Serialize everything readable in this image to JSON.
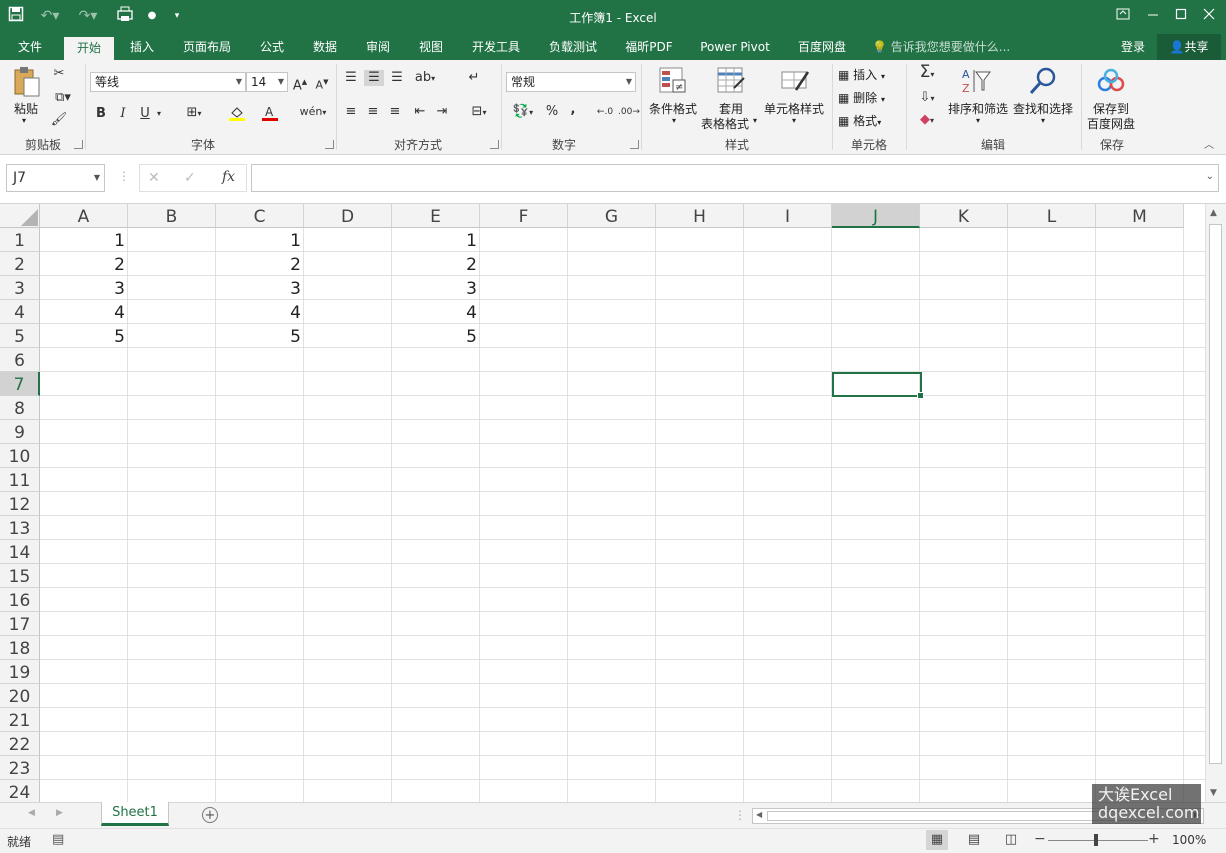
{
  "title_bar": {
    "title": "工作簿1 - Excel",
    "window_controls": [
      "ribbon-display-icon",
      "minimize-icon",
      "maximize-icon",
      "close-icon"
    ]
  },
  "tabs": [
    {
      "label": "文件"
    },
    {
      "label": "开始"
    },
    {
      "label": "插入"
    },
    {
      "label": "页面布局"
    },
    {
      "label": "公式"
    },
    {
      "label": "数据"
    },
    {
      "label": "审阅"
    },
    {
      "label": "视图"
    },
    {
      "label": "开发工具"
    },
    {
      "label": "负载测试"
    },
    {
      "label": "福昕PDF"
    },
    {
      "label": "Power Pivot"
    },
    {
      "label": "百度网盘"
    }
  ],
  "tell_me": "告诉我您想要做什么...",
  "login": "登录",
  "share": "共享",
  "ribbon": {
    "clipboard": {
      "label": "剪贴板",
      "paste": "粘贴"
    },
    "font": {
      "label": "字体",
      "name": "等线",
      "size": "14",
      "bold": "B",
      "italic": "I",
      "underline": "U"
    },
    "alignment": {
      "label": "对齐方式"
    },
    "number": {
      "label": "数字",
      "format": "常规",
      "percent": "%",
      "comma": ","
    },
    "styles": {
      "label": "样式",
      "conditional": "条件格式",
      "table_1": "套用",
      "table_2": "表格格式",
      "cell_styles": "单元格样式"
    },
    "cells": {
      "label": "单元格",
      "insert": "插入",
      "delete": "删除",
      "format": "格式"
    },
    "editing": {
      "label": "编辑",
      "sort_filter": "排序和筛选",
      "find_select": "查找和选择"
    },
    "save": {
      "label": "保存",
      "save_1": "保存到",
      "save_2": "百度网盘"
    }
  },
  "formula_bar": {
    "name_box": "J7",
    "fx": "fx",
    "formula": ""
  },
  "columns": [
    "A",
    "B",
    "C",
    "D",
    "E",
    "F",
    "G",
    "H",
    "I",
    "J",
    "K",
    "L",
    "M"
  ],
  "rows": [
    "1",
    "2",
    "3",
    "4",
    "5",
    "6",
    "7",
    "8",
    "9",
    "10",
    "11",
    "12",
    "13",
    "14",
    "15",
    "16",
    "17",
    "18",
    "19",
    "20",
    "21",
    "22",
    "23",
    "24"
  ],
  "cells": {
    "A": [
      "1",
      "2",
      "3",
      "4",
      "5"
    ],
    "C": [
      "1",
      "2",
      "3",
      "4",
      "5"
    ],
    "E": [
      "1",
      "2",
      "3",
      "4",
      "5"
    ]
  },
  "active_cell": "J7",
  "sheet_tab": "Sheet1",
  "status": {
    "ready": "就绪",
    "zoom": "100%"
  },
  "watermark": {
    "line1": "大诶Excel",
    "line2": "dqexcel.com"
  },
  "colors": {
    "brand": "#217346",
    "ribbon_bg": "#f3f3f3"
  }
}
